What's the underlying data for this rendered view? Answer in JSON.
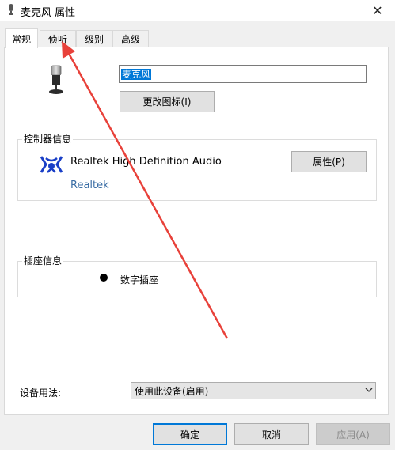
{
  "window": {
    "title": "麦克风 属性",
    "close": "✕"
  },
  "tabs": [
    {
      "label": "常规",
      "active": true
    },
    {
      "label": "侦听",
      "active": false
    },
    {
      "label": "级别",
      "active": false
    },
    {
      "label": "高级",
      "active": false
    }
  ],
  "device": {
    "name_value": "麦克风",
    "change_icon_label": "更改图标(I)"
  },
  "controller": {
    "group_label": "控制器信息",
    "name": "Realtek High Definition Audio",
    "vendor_link": "Realtek",
    "properties_label": "属性(P)"
  },
  "jack": {
    "group_label": "插座信息",
    "text": "数字插座"
  },
  "usage": {
    "label": "设备用法:",
    "selected": "使用此设备(启用)"
  },
  "footer": {
    "ok": "确定",
    "cancel": "取消",
    "apply": "应用(A)"
  },
  "annotation": {
    "color": "#e8413a"
  },
  "colors": {
    "accent": "#0078d7",
    "link": "#3b6ea5",
    "realtek_blue": "#1a3fc7"
  }
}
